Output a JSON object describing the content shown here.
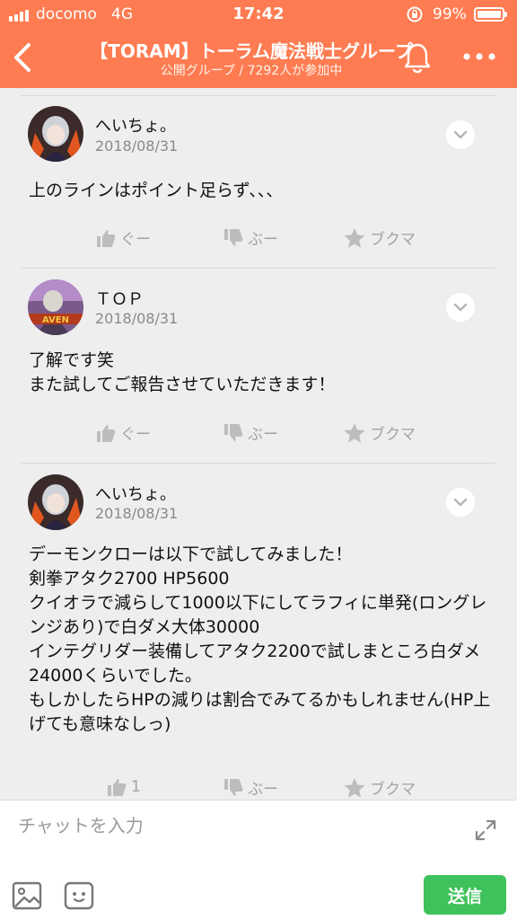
{
  "status_bar": {
    "carrier": "docomo",
    "network": "4G",
    "time": "17:42",
    "battery_percent": "99%",
    "battery_level": 0.99
  },
  "header": {
    "title": "【TORAM】トーラム魔法戦士グループ",
    "subtitle": "公開グループ / 7292人が参加中"
  },
  "posts": [
    {
      "author": "へいちょ。",
      "date": "2018/08/31",
      "body": "上のラインはポイント足らず、、、",
      "like_label": "ぐー",
      "dislike_label": "ぶー",
      "bookmark_label": "ブクマ"
    },
    {
      "author": "ＴＯＰ",
      "date": "2018/08/31",
      "body": "了解です笑\nまた試してご報告させていただきます！",
      "like_label": "ぐー",
      "dislike_label": "ぶー",
      "bookmark_label": "ブクマ"
    },
    {
      "author": "へいちょ。",
      "date": "2018/08/31",
      "body": "デーモンクローは以下で試してみました！\n剣拳アタク2700 HP5600\nクイオラで減らして1000以下にしてラフィに単発(ロングレンジあり)で白ダメ大体30000\nインテグリダー装備してアタク2200で試しまところ白ダメ24000くらいでした。\nもしかしたらHPの減りは割合でみてるかもしれません(HP上げても意味なしっ)",
      "like_label": "1",
      "dislike_label": "ぶー",
      "bookmark_label": "ブクマ"
    }
  ],
  "composer": {
    "placeholder": "チャットを入力",
    "send_label": "送信"
  },
  "colors": {
    "header_bg": "#ff7c52",
    "send_bg": "#3fc25b",
    "feed_bg": "#eeeeee"
  }
}
